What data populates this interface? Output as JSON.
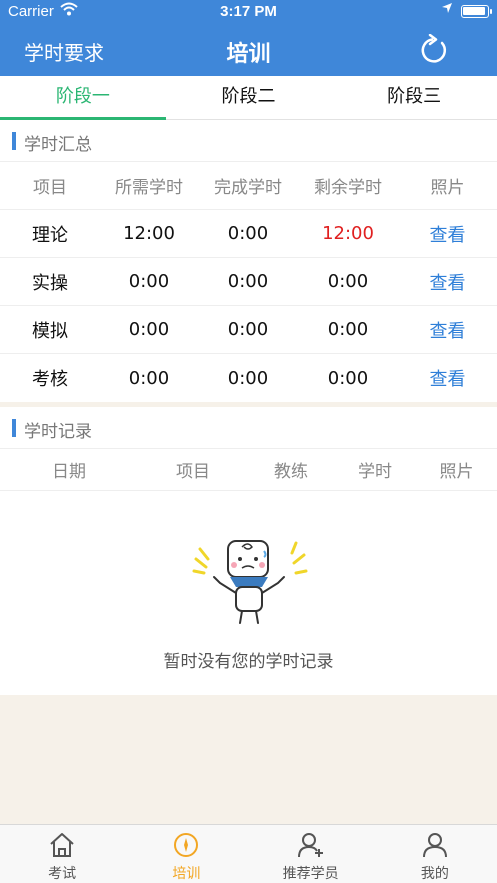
{
  "status_bar": {
    "carrier": "Carrier",
    "time": "3:17 PM"
  },
  "nav": {
    "left_label": "学时要求",
    "title": "培训",
    "refresh_icon": "refresh-icon"
  },
  "tabs": [
    {
      "label": "阶段一",
      "active": true
    },
    {
      "label": "阶段二",
      "active": false
    },
    {
      "label": "阶段三",
      "active": false
    }
  ],
  "summary": {
    "title": "学时汇总",
    "columns": [
      "项目",
      "所需学时",
      "完成学时",
      "剩余学时",
      "照片"
    ],
    "rows": [
      {
        "item": "理论",
        "required": "12:00",
        "done": "0:00",
        "remaining": "12:00",
        "photo": "查看"
      },
      {
        "item": "实操",
        "required": "0:00",
        "done": "0:00",
        "remaining": "0:00",
        "photo": "查看"
      },
      {
        "item": "模拟",
        "required": "0:00",
        "done": "0:00",
        "remaining": "0:00",
        "photo": "查看"
      },
      {
        "item": "考核",
        "required": "0:00",
        "done": "0:00",
        "remaining": "0:00",
        "photo": "查看"
      }
    ]
  },
  "records": {
    "title": "学时记录",
    "columns": [
      "日期",
      "项目",
      "教练",
      "学时",
      "照片"
    ],
    "empty_message": "暂时没有您的学时记录"
  },
  "colors": {
    "brand_blue": "#3f87d9",
    "tab_active_green": "#2bb673",
    "warning_red": "#e02020",
    "link_blue": "#2f7fd8",
    "tabbar_active_orange": "#f2a623"
  },
  "tabbar": [
    {
      "label": "考试",
      "icon": "home-icon",
      "active": false
    },
    {
      "label": "培训",
      "icon": "compass-icon",
      "active": true
    },
    {
      "label": "推荐学员",
      "icon": "add-user-icon",
      "active": false
    },
    {
      "label": "我的",
      "icon": "user-icon",
      "active": false
    }
  ]
}
